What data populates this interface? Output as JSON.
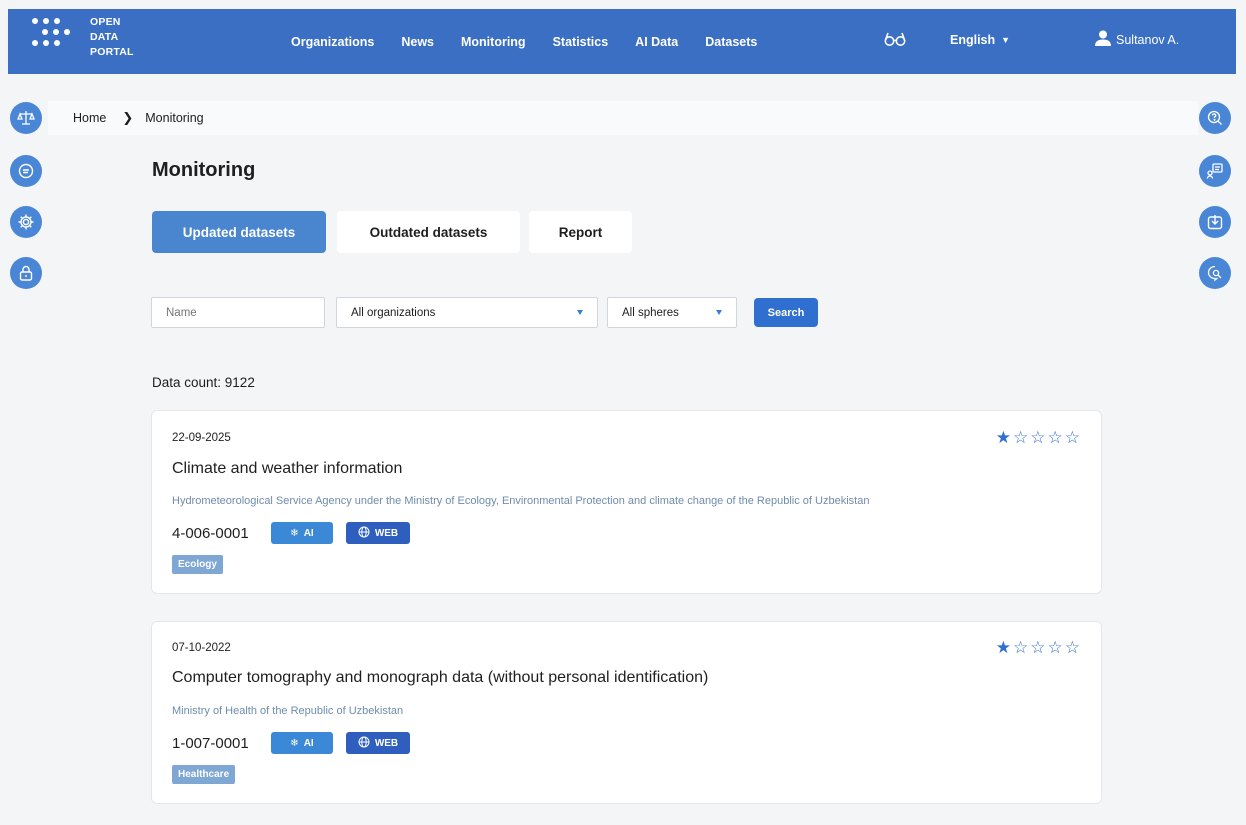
{
  "header": {
    "logo_lines": [
      "OPEN",
      "DATA",
      "PORTAL"
    ],
    "nav": [
      "Organizations",
      "News",
      "Monitoring",
      "Statistics",
      "AI Data",
      "Datasets"
    ],
    "accessibility_icon": "glasses-icon",
    "language": "English",
    "user": "Sultanov A."
  },
  "left_sidebar": {
    "icons": [
      "scales-icon",
      "chat-icon",
      "gear-icon",
      "lock-icon"
    ]
  },
  "right_sidebar": {
    "icons": [
      "help-chat-icon",
      "feedback-icon",
      "download-icon",
      "search-chat-icon"
    ]
  },
  "breadcrumb": {
    "home": "Home",
    "separator": "❯",
    "current": "Monitoring"
  },
  "page": {
    "title": "Monitoring"
  },
  "tabs": [
    {
      "label": "Updated datasets",
      "active": true
    },
    {
      "label": "Outdated datasets",
      "active": false
    },
    {
      "label": "Report",
      "active": false
    }
  ],
  "filters": {
    "name_placeholder": "Name",
    "organization": "All organizations",
    "sphere": "All spheres",
    "search_label": "Search"
  },
  "data_count": "Data count: 9122",
  "datasets": [
    {
      "date": "22-09-2025",
      "title": "Climate and weather information",
      "organization": "Hydrometeorological Service Agency under the Ministry of Ecology, Environmental Protection and climate change of the Republic of Uzbekistan",
      "code": "4-006-0001",
      "badges": [
        "AI",
        "WEB"
      ],
      "sphere": "Ecology",
      "rating": 1,
      "rating_max": 5
    },
    {
      "date": "07-10-2022",
      "title": "Computer tomography and monograph data (without personal identification)",
      "organization": "Ministry of Health of the Republic of Uzbekistan",
      "code": "1-007-0001",
      "badges": [
        "AI",
        "WEB"
      ],
      "sphere": "Healthcare",
      "rating": 1,
      "rating_max": 5
    }
  ],
  "colors": {
    "header": "#3a6fc4",
    "active_tab": "#4a86d0",
    "search_button": "#2f6fd0",
    "side_button": "#4a86d6",
    "ai_badge": "#3b89d6",
    "web_badge": "#2e5fbf",
    "sphere_badge": "#7ea7d3"
  }
}
